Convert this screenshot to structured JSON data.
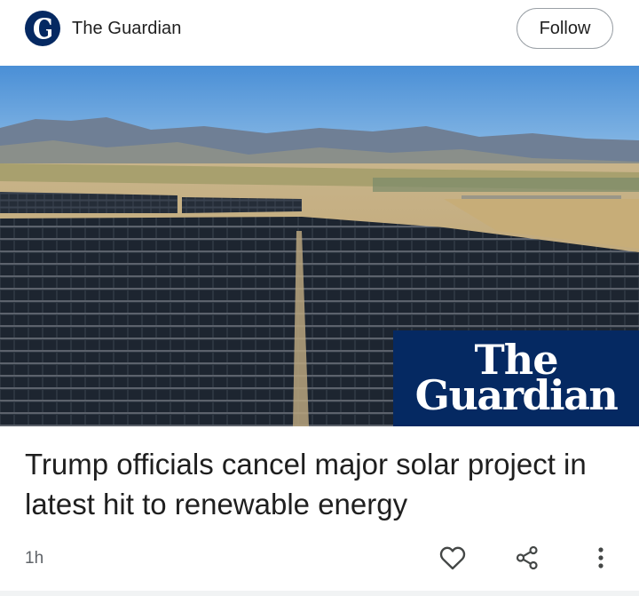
{
  "source": {
    "name": "The Guardian",
    "logo_icon": "guardian-g-logo-icon",
    "follow_label": "Follow"
  },
  "image": {
    "description_icon": "solar-farm-photo",
    "brand_line1": "The",
    "brand_line2": "Guardian",
    "brand_color": "#052962"
  },
  "article": {
    "headline": "Trump officials cancel major solar project in latest hit to renewable energy",
    "age": "1h"
  },
  "actions": {
    "like_icon": "heart-icon",
    "share_icon": "share-icon",
    "more_icon": "more-vert-icon"
  }
}
